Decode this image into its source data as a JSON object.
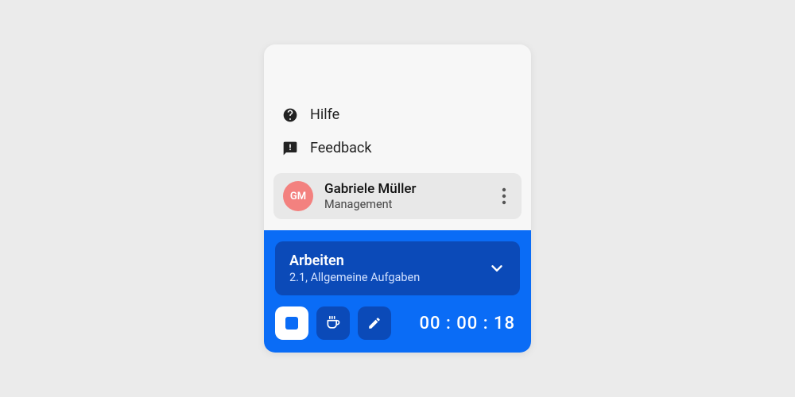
{
  "menu": {
    "help_label": "Hilfe",
    "feedback_label": "Feedback"
  },
  "user": {
    "initials": "GM",
    "name": "Gabriele Müller",
    "role": "Management"
  },
  "task": {
    "title": "Arbeiten",
    "subtitle": "2.1, Allgemeine Aufgaben"
  },
  "timer": {
    "display": "00 : 00 : 18"
  }
}
